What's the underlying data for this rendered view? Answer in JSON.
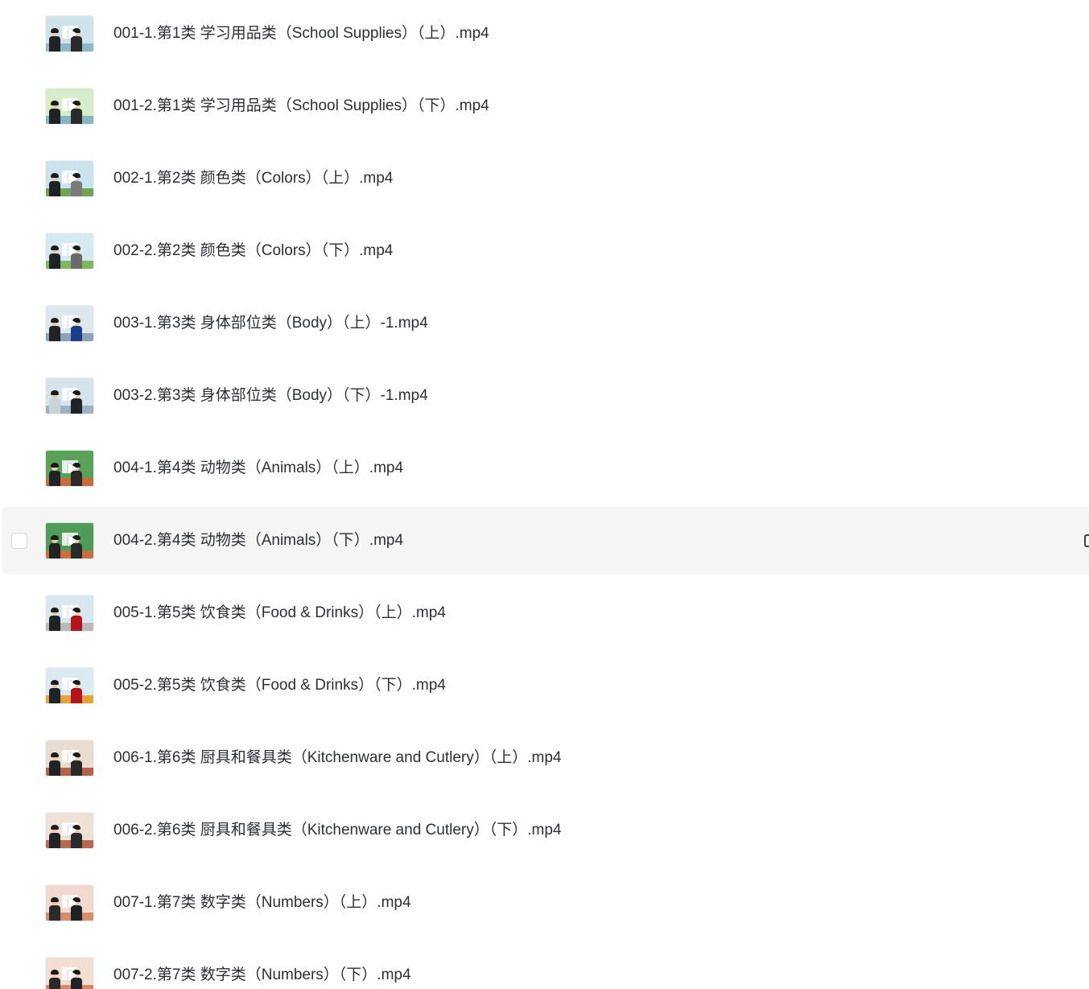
{
  "files": [
    {
      "name": "001-1.第1类 学习用品类（School Supplies）（上）.mp4",
      "thumb": {
        "bg": "#cfe3ec",
        "floor": "#8fb8c9",
        "a": "#1f2326",
        "b": "#2a2a2a"
      }
    },
    {
      "name": "001-2.第1类 学习用品类（School Supplies）（下）.mp4",
      "thumb": {
        "bg": "#d7ecc8",
        "floor": "#86b6c4",
        "a": "#1f2326",
        "b": "#2a2a2a"
      }
    },
    {
      "name": "002-1.第2类 颜色类（Colors）（上）.mp4",
      "thumb": {
        "bg": "#c9e4ef",
        "floor": "#6fa34f",
        "a": "#1f2326",
        "b": "#7a7a7a"
      }
    },
    {
      "name": "002-2.第2类 颜色类（Colors）（下）.mp4",
      "thumb": {
        "bg": "#d3eaf2",
        "floor": "#7fb661",
        "a": "#1f2326",
        "b": "#6b6b6b"
      }
    },
    {
      "name": "003-1.第3类 身体部位类（Body）（上）-1.mp4",
      "thumb": {
        "bg": "#dde7ee",
        "floor": "#8aa3b5",
        "a": "#1f2326",
        "b": "#1c3d8c"
      }
    },
    {
      "name": "003-2.第3类 身体部位类（Body）（下）-1.mp4",
      "thumb": {
        "bg": "#d6e3ec",
        "floor": "#9cb2c2",
        "a": "#c8d4dc",
        "b": "#1f2326"
      }
    },
    {
      "name": "004-1.第4类 动物类（Animals）（上）.mp4",
      "thumb": {
        "bg": "#5aa25a",
        "floor": "#c86b3c",
        "a": "#1f2326",
        "b": "#2a2a2a"
      }
    },
    {
      "name": "004-2.第4类 动物类（Animals）（下）.mp4",
      "thumb": {
        "bg": "#4f9b5a",
        "floor": "#c2703f",
        "a": "#1f2326",
        "b": "#2a2a2a"
      },
      "hovered": true
    },
    {
      "name": "005-1.第5类 饮食类（Food & Drinks）（上）.mp4",
      "thumb": {
        "bg": "#d9e8ee",
        "floor": "#b9b9b9",
        "a": "#1f2326",
        "b": "#b3141e"
      }
    },
    {
      "name": "005-2.第5类 饮食类（Food & Drinks）（下）.mp4",
      "thumb": {
        "bg": "#dbe9f0",
        "floor": "#e3a33b",
        "a": "#1f2326",
        "b": "#b3141e"
      }
    },
    {
      "name": "006-1.第6类 厨具和餐具类（Kitchenware and Cutlery）（上）.mp4",
      "thumb": {
        "bg": "#e9dcd0",
        "floor": "#b5614a",
        "a": "#1f2326",
        "b": "#2a2a2a"
      }
    },
    {
      "name": "006-2.第6类 厨具和餐具类（Kitchenware and Cutlery）（下）.mp4",
      "thumb": {
        "bg": "#eee1d6",
        "floor": "#b8684f",
        "a": "#1f2326",
        "b": "#2a2a2a"
      }
    },
    {
      "name": "007-1.第7类 数字类（Numbers）（上）.mp4",
      "thumb": {
        "bg": "#f1d9cf",
        "floor": "#d88b6d",
        "a": "#2a2a2a",
        "b": "#1f2326"
      }
    },
    {
      "name": "007-2.第7类 数字类（Numbers）（下）.mp4",
      "thumb": {
        "bg": "#f3ded3",
        "floor": "#d9896b",
        "a": "#2a2a2a",
        "b": "#1f2326"
      }
    }
  ]
}
